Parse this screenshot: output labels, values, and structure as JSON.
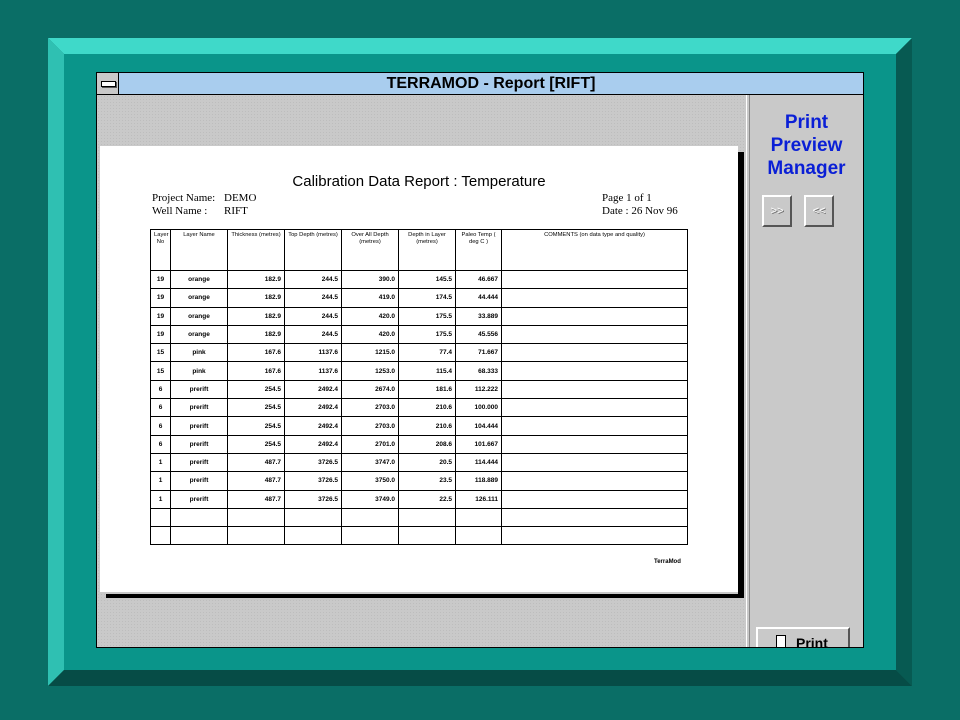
{
  "window": {
    "title": "TERRAMOD - Report [RIFT]"
  },
  "side_panel": {
    "title_lines": [
      "Print",
      "Preview",
      "Manager"
    ],
    "next_button_label": ">>",
    "prev_button_label": "<<",
    "print_button_label": "Print"
  },
  "report": {
    "title": "Calibration Data Report : Temperature",
    "project_label": "Project Name:",
    "project_value": "DEMO",
    "well_label": "Well Name :",
    "well_value": "RIFT",
    "page": "Page 1 of 1",
    "date": "Date : 26 Nov 96",
    "footer_mark": "TerraMod",
    "columns": [
      "Layer No",
      "Layer Name",
      "Thickness (metres)",
      "Top Depth (metres)",
      "Over All Depth (metres)",
      "Depth in Layer (metres)",
      "Paleo Temp ( deg C )",
      "COMMENTS (on data type and quality)"
    ],
    "rows": [
      [
        "19",
        "orange",
        "182.9",
        "244.5",
        "390.0",
        "145.5",
        "46.667",
        ""
      ],
      [
        "19",
        "orange",
        "182.9",
        "244.5",
        "419.0",
        "174.5",
        "44.444",
        ""
      ],
      [
        "19",
        "orange",
        "182.9",
        "244.5",
        "420.0",
        "175.5",
        "33.889",
        ""
      ],
      [
        "19",
        "orange",
        "182.9",
        "244.5",
        "420.0",
        "175.5",
        "45.556",
        ""
      ],
      [
        "15",
        "pink",
        "167.6",
        "1137.6",
        "1215.0",
        "77.4",
        "71.667",
        ""
      ],
      [
        "15",
        "pink",
        "167.6",
        "1137.6",
        "1253.0",
        "115.4",
        "68.333",
        ""
      ],
      [
        "6",
        "prerift",
        "254.5",
        "2492.4",
        "2674.0",
        "181.6",
        "112.222",
        ""
      ],
      [
        "6",
        "prerift",
        "254.5",
        "2492.4",
        "2703.0",
        "210.6",
        "100.000",
        ""
      ],
      [
        "6",
        "prerift",
        "254.5",
        "2492.4",
        "2703.0",
        "210.6",
        "104.444",
        ""
      ],
      [
        "6",
        "prerift",
        "254.5",
        "2492.4",
        "2701.0",
        "208.6",
        "101.667",
        ""
      ],
      [
        "1",
        "prerift",
        "487.7",
        "3726.5",
        "3747.0",
        "20.5",
        "114.444",
        ""
      ],
      [
        "1",
        "prerift",
        "487.7",
        "3726.5",
        "3750.0",
        "23.5",
        "118.889",
        ""
      ],
      [
        "1",
        "prerift",
        "487.7",
        "3726.5",
        "3749.0",
        "22.5",
        "126.111",
        ""
      ]
    ],
    "blank_rows": 2
  },
  "colors": {
    "background": "#0a6e66",
    "slide_inner": "#0a958a",
    "titlebar": "#a9cdee",
    "panel_title": "#0a1fd6",
    "window_face": "#c9c9c9"
  },
  "icons": {
    "system_menu": "system-menu-icon",
    "print": "printer-page-icon"
  }
}
